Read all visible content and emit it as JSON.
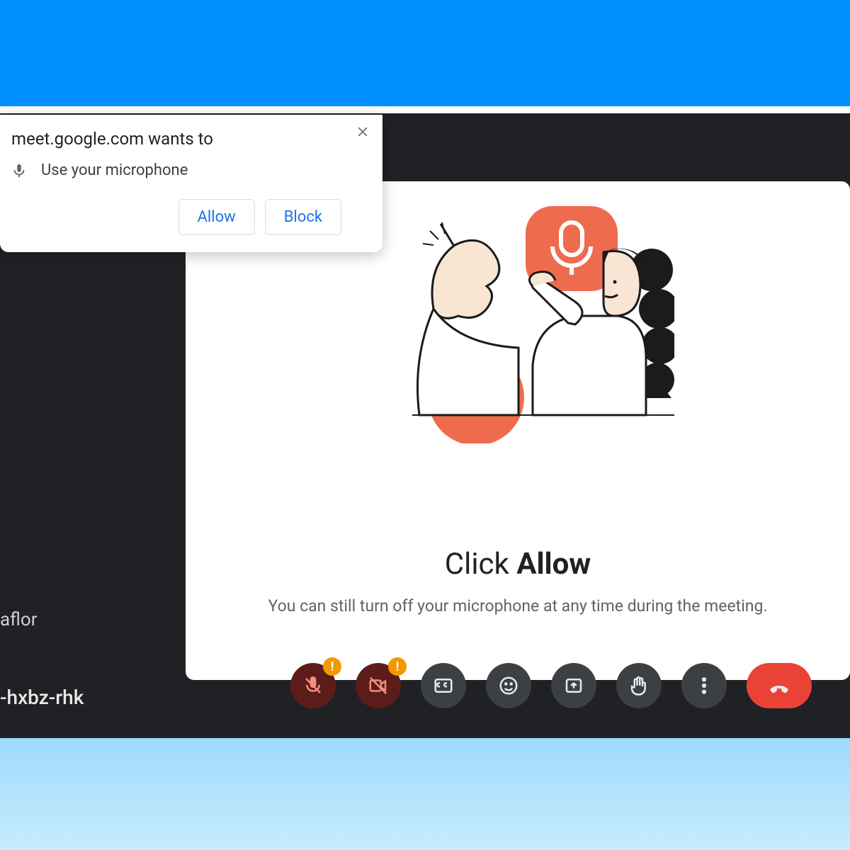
{
  "permission": {
    "title": "meet.google.com wants to",
    "request": "Use your microphone",
    "allow": "Allow",
    "block": "Block"
  },
  "panel": {
    "title_pre": "Click ",
    "title_bold": "Allow",
    "desc": "You can still turn off your microphone at any time during the meeting."
  },
  "meeting": {
    "participant_fragment": "aflor",
    "code_fragment": "-hxbz-rhk"
  },
  "warn_badge": "!",
  "colors": {
    "accent": "#1a73e8",
    "illustration": "#ee6c4d",
    "end_call": "#ea4335"
  }
}
